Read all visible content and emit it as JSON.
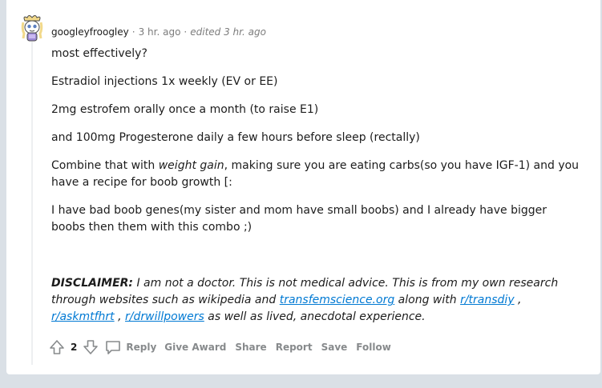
{
  "comment": {
    "username": "googleyfroogley",
    "separator": "·",
    "time": "3 hr. ago",
    "edited": "edited 3 hr. ago",
    "paragraphs": [
      "most effectively?",
      "Estradiol injections 1x weekly (EV or EE)",
      "2mg estrofem orally once a month (to raise E1)",
      "and 100mg Progesterone daily a few hours before sleep (rectally)"
    ],
    "combine": {
      "pre": "Combine that with ",
      "emph": "weight gain",
      "post": ", making sure you are eating carbs(so you have IGF-1) and you have a recipe for boob growth [:"
    },
    "genes": "I have bad boob genes(my sister and mom have small boobs) and I already have bigger boobs then them with this combo ;)",
    "disclaimer": {
      "label": "DISCLAIMER:",
      "text1": " I am not a doctor. This is not medical advice. This is from my own research through websites such as wikipedia and ",
      "link1": "transfemscience.org",
      "text2": " along with ",
      "link2": "r/transdiy",
      "sep1": " , ",
      "link3": "r/askmtfhrt",
      "sep2": " , ",
      "link4": "r/drwillpowers",
      "text3": " as well as lived, anecdotal experience."
    },
    "actions": {
      "score": "2",
      "reply": "Reply",
      "give_award": "Give Award",
      "share": "Share",
      "report": "Report",
      "save": "Save",
      "follow": "Follow"
    }
  },
  "icons": {
    "avatar": "snoo-avatar-icon",
    "upvote": "upvote-arrow-icon",
    "downvote": "downvote-arrow-icon",
    "reply": "comment-bubble-icon"
  },
  "colors": {
    "background": "#dae0e6",
    "card": "#ffffff",
    "link": "#0079d3",
    "muted": "#878a8c"
  }
}
